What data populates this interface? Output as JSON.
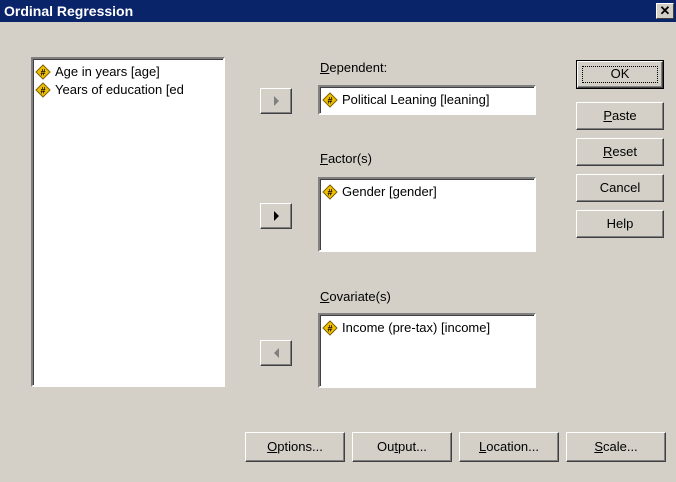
{
  "window": {
    "title": "Ordinal Regression",
    "close_glyph": "✕"
  },
  "source_list": {
    "items": [
      {
        "label": "Age in years [age]",
        "icon": "scale-variable-icon"
      },
      {
        "label": "Years of education [ed",
        "icon": "scale-variable-icon"
      }
    ]
  },
  "dependent": {
    "label_mnemonic": "D",
    "label_rest": "ependent:",
    "value": "Political Leaning [leaning]",
    "icon": "scale-variable-icon",
    "arrow_state": "disabled"
  },
  "factors": {
    "label_mnemonic": "F",
    "label_rest": "actor(s)",
    "items": [
      "Gender [gender]"
    ],
    "icon": "scale-variable-icon",
    "arrow_state": "enabled"
  },
  "covariates": {
    "label_mnemonic": "C",
    "label_rest": "ovariate(s)",
    "items": [
      "Income (pre-tax) [income]"
    ],
    "icon": "scale-variable-icon",
    "arrow_state": "disabled"
  },
  "buttons": {
    "ok": "OK",
    "paste_mn": "P",
    "paste_rest": "aste",
    "reset_mn": "R",
    "reset_rest": "eset",
    "cancel": "Cancel",
    "help": "Help"
  },
  "bottom_buttons": {
    "options_mn": "O",
    "options_rest": "ptions...",
    "output_pre": "Ou",
    "output_mn": "t",
    "output_rest": "put...",
    "location_mn": "L",
    "location_rest": "ocation...",
    "scale_mn": "S",
    "scale_rest": "cale..."
  },
  "colors": {
    "titlebar": "#0a246a",
    "face": "#d4d0c8",
    "icon_fill": "#f0c000"
  }
}
